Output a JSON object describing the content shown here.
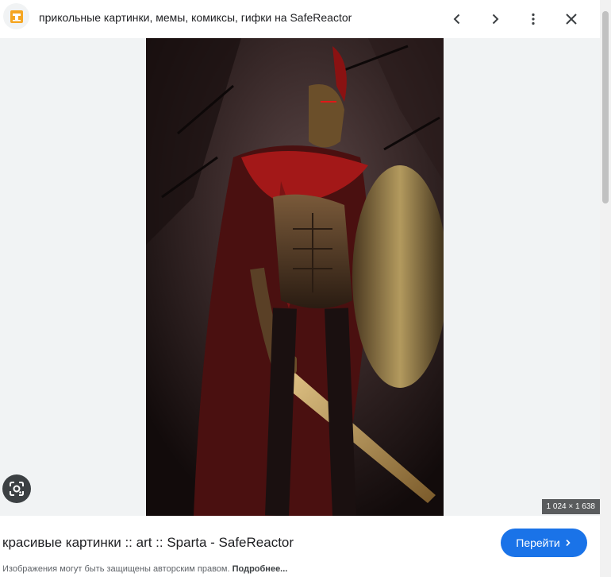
{
  "header": {
    "site_title": "прикольные картинки, мемы, комиксы, гифки на SafeReactor",
    "favicon_icon": "safereactor-favicon-icon",
    "prev_icon": "chevron-left-icon",
    "next_icon": "chevron-right-icon",
    "more_icon": "more-vert-icon",
    "close_icon": "close-icon"
  },
  "viewer": {
    "lens_icon": "google-lens-icon",
    "image_dimensions": "1 024 × 1 638"
  },
  "result": {
    "caption": "красивые картинки :: art :: Sparta - SafeReactor",
    "go_button_label": "Перейти",
    "go_button_icon": "chevron-right-icon",
    "copyright_note": "Изображения могут быть защищены авторским правом.",
    "more_link": "Подробнее..."
  },
  "colors": {
    "accent": "#1a73e8",
    "favicon": "#f5a623",
    "viewer_bg": "#f1f3f4"
  }
}
